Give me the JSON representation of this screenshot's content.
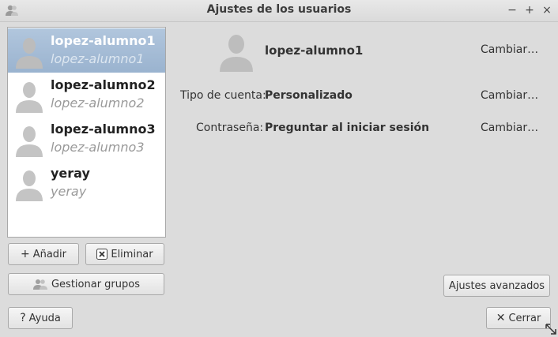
{
  "window": {
    "title": "Ajustes de los usuarios",
    "minimize": "−",
    "maximize": "+",
    "close": "×"
  },
  "users": [
    {
      "name": "lopez-alumno1",
      "login": "lopez-alumno1",
      "selected": true
    },
    {
      "name": "lopez-alumno2",
      "login": "lopez-alumno2",
      "selected": false
    },
    {
      "name": "lopez-alumno3",
      "login": "lopez-alumno3",
      "selected": false
    },
    {
      "name": "yeray",
      "login": "yeray",
      "selected": false
    }
  ],
  "buttons": {
    "add": "Añadir",
    "add_icon": "+",
    "delete": "Eliminar",
    "groups": "Gestionar grupos",
    "help": "Ayuda",
    "help_icon": "?",
    "advanced": "Ajustes avanzados",
    "close": "Cerrar",
    "close_icon": "✕"
  },
  "detail": {
    "username": "lopez-alumno1",
    "change_name": "Cambiar…",
    "account_type_label": "Tipo de cuenta:",
    "account_type_value": "Personalizado",
    "change_type": "Cambiar…",
    "password_label": "Contraseña:",
    "password_value": "Preguntar al iniciar sesión",
    "change_password": "Cambiar…"
  },
  "icons": {
    "window": "users-icon",
    "avatar": "user-avatar-icon",
    "delete": "delete-icon",
    "groups": "group-icon",
    "resize": "resize-grip-icon"
  },
  "colors": {
    "selection": "#a7bdd6",
    "background": "#dcdcdc"
  }
}
